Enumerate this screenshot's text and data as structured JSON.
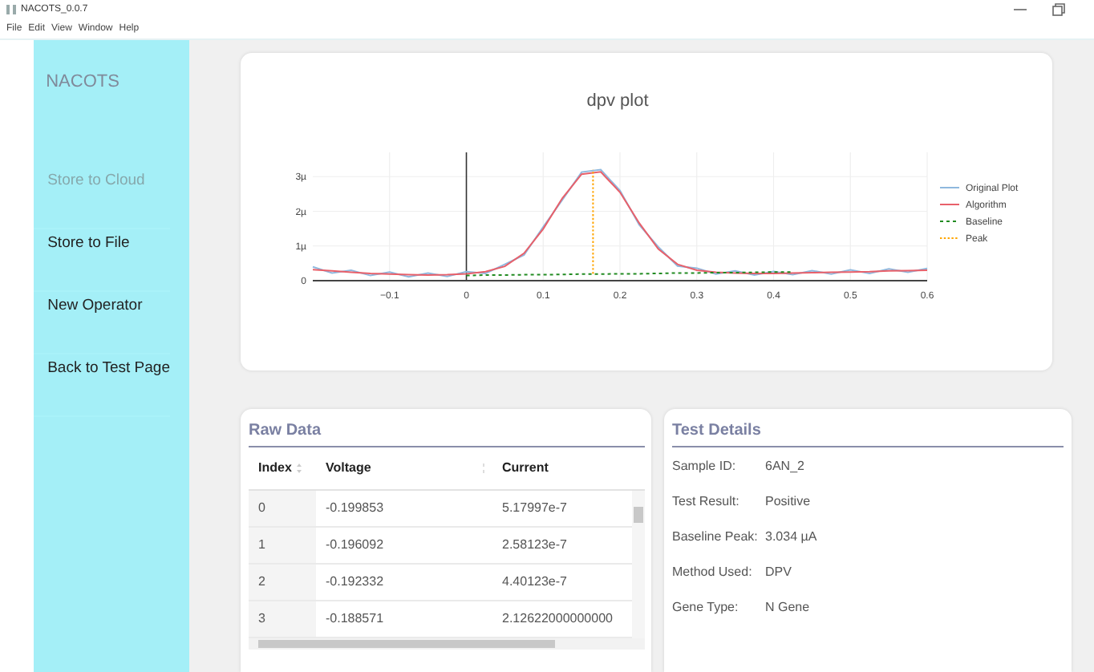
{
  "window": {
    "title": "NACOTS_0.0.7"
  },
  "menu": [
    "File",
    "Edit",
    "View",
    "Window",
    "Help"
  ],
  "sidebar": {
    "title": "NACOTS",
    "items": [
      {
        "label": "Store to Cloud",
        "disabled": true
      },
      {
        "label": "Store to File",
        "disabled": false
      },
      {
        "label": "New Operator",
        "disabled": false
      },
      {
        "label": "Back to Test Page",
        "disabled": false
      }
    ]
  },
  "plot": {
    "chart_data": {
      "type": "line",
      "title": "dpv plot",
      "x": [
        -0.2,
        -0.175,
        -0.15,
        -0.125,
        -0.1,
        -0.075,
        -0.05,
        -0.025,
        0,
        0.025,
        0.05,
        0.075,
        0.1,
        0.125,
        0.15,
        0.175,
        0.2,
        0.225,
        0.25,
        0.275,
        0.3,
        0.325,
        0.35,
        0.375,
        0.4,
        0.425,
        0.45,
        0.475,
        0.5,
        0.525,
        0.55,
        0.575,
        0.6
      ],
      "xlim": [
        -0.2,
        0.6
      ],
      "ylim": [
        0,
        3.7
      ],
      "grid": true,
      "legend": true,
      "xticks": [
        -0.1,
        0,
        0.1,
        0.2,
        0.3,
        0.4,
        0.5,
        0.6
      ],
      "yticks": [
        {
          "value": 0,
          "label": "0"
        },
        {
          "value": 1,
          "label": "1µ"
        },
        {
          "value": 2,
          "label": "2µ"
        },
        {
          "value": 3,
          "label": "3µ"
        }
      ],
      "series": [
        {
          "name": "Original Plot",
          "color": "#8fb8de",
          "line_style": "solid",
          "values": [
            0.4,
            0.22,
            0.3,
            0.15,
            0.25,
            0.11,
            0.22,
            0.12,
            0.26,
            0.21,
            0.47,
            0.74,
            1.55,
            2.33,
            3.13,
            3.2,
            2.6,
            1.61,
            0.97,
            0.42,
            0.36,
            0.19,
            0.28,
            0.16,
            0.27,
            0.17,
            0.29,
            0.19,
            0.31,
            0.21,
            0.34,
            0.24,
            0.35
          ]
        },
        {
          "name": "Algorithm",
          "color": "#e8606a",
          "line_style": "solid",
          "values": [
            0.32,
            0.28,
            0.24,
            0.21,
            0.19,
            0.17,
            0.16,
            0.17,
            0.2,
            0.26,
            0.41,
            0.79,
            1.49,
            2.38,
            3.07,
            3.14,
            2.55,
            1.66,
            0.91,
            0.47,
            0.3,
            0.24,
            0.22,
            0.21,
            0.21,
            0.22,
            0.23,
            0.24,
            0.25,
            0.26,
            0.28,
            0.29,
            0.3
          ]
        },
        {
          "name": "Baseline",
          "color": "#228b22",
          "line_style": "dashed",
          "values": [
            null,
            null,
            null,
            null,
            null,
            null,
            null,
            null,
            0.15,
            0.16,
            0.16,
            0.17,
            0.17,
            0.18,
            0.19,
            0.19,
            0.2,
            0.2,
            0.21,
            0.22,
            0.22,
            0.23,
            0.23,
            0.24,
            0.25,
            0.25,
            null,
            null,
            null,
            null,
            null,
            null,
            null
          ]
        },
        {
          "name": "Peak",
          "color": "#ffa500",
          "line_style": "dotted",
          "x": [
            0.165,
            0.165
          ],
          "values": [
            0.2,
            3.2
          ]
        }
      ]
    }
  },
  "raw_data": {
    "title": "Raw Data",
    "columns": [
      "Index",
      "Voltage",
      "Current"
    ],
    "rows": [
      [
        "0",
        "-0.199853",
        "5.17997e-7"
      ],
      [
        "1",
        "-0.196092",
        "2.58123e-7"
      ],
      [
        "2",
        "-0.192332",
        "4.40123e-7"
      ],
      [
        "3",
        "-0.188571",
        "2.12622000000000"
      ]
    ]
  },
  "test_details": {
    "title": "Test Details",
    "fields": [
      {
        "label": "Sample ID:",
        "value": "6AN_2"
      },
      {
        "label": "Test Result:",
        "value": "Positive"
      },
      {
        "label": "Baseline Peak:",
        "value": "3.034 µA"
      },
      {
        "label": "Method Used:",
        "value": "DPV"
      },
      {
        "label": "Gene Type:",
        "value": "N Gene"
      }
    ]
  }
}
